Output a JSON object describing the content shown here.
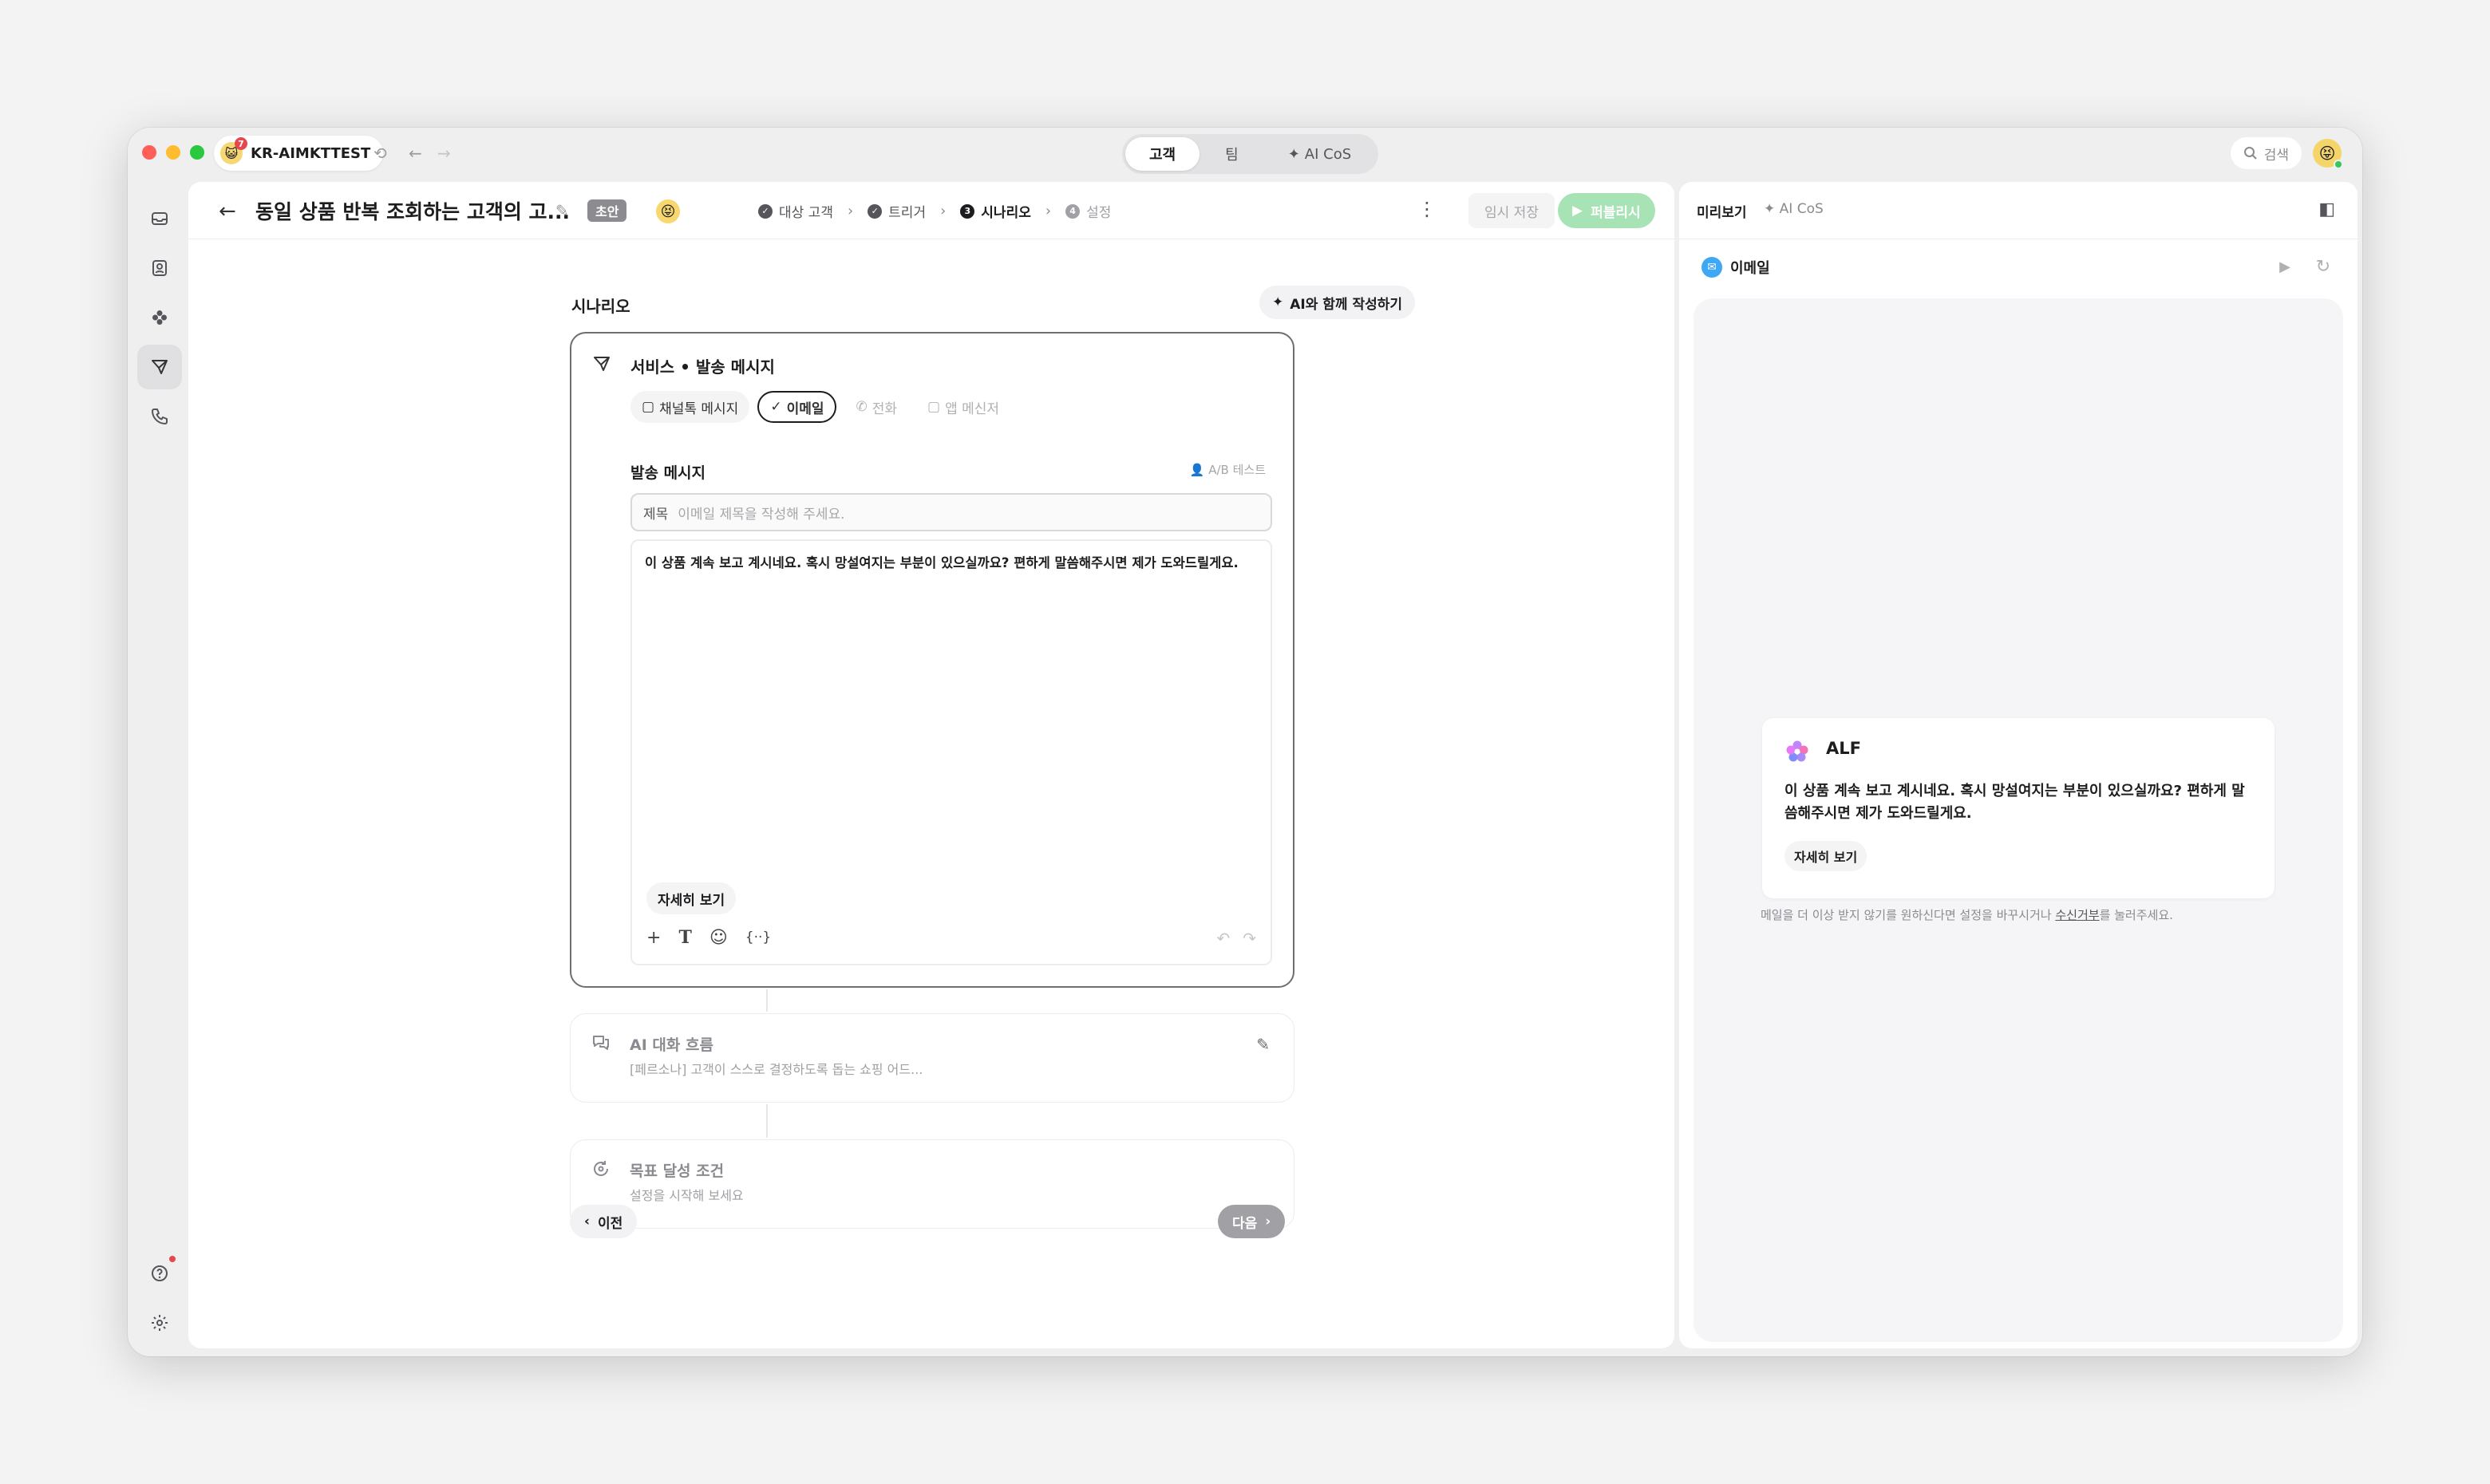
{
  "titlebar": {
    "workspace": "KR-AIMKTTEST",
    "workspace_badge": "7",
    "tabs": [
      "고객",
      "팀",
      "AI CoS"
    ],
    "active_tab": 0,
    "search_label": "검색"
  },
  "header": {
    "title": "동일 상품 반복 조회하는 고객의 고...",
    "status_badge": "초안",
    "steps": [
      {
        "label": "대상 고객",
        "state": "done"
      },
      {
        "label": "트리거",
        "state": "done"
      },
      {
        "label": "시나리오",
        "state": "current",
        "num": "3"
      },
      {
        "label": "설정",
        "state": "future",
        "num": "4"
      }
    ],
    "temp_save": "임시 저장",
    "publish": "퍼블리시"
  },
  "scenario": {
    "section_title": "시나리오",
    "ai_write": "AI와 함께 작성하기",
    "card_title": "서비스  •  발송 메시지",
    "channels": [
      {
        "label": "채널톡 메시지",
        "state": "unselected"
      },
      {
        "label": "이메일",
        "state": "selected"
      },
      {
        "label": "전화",
        "state": "disabled"
      },
      {
        "label": "앱 메신저",
        "state": "disabled"
      }
    ],
    "message_label": "발송 메시지",
    "ab_test": "A/B 테스트",
    "subject_label": "제목",
    "subject_placeholder": "이메일 제목을 작성해 주세요.",
    "body": "이 상품 계속 보고 계시네요. 혹시 망설여지는 부분이 있으실까요? 편하게 말씀해주시면 제가 도와드릴게요.",
    "detail_button": "자세히 보기",
    "ai_flow_title": "AI 대화 흐름",
    "ai_flow_sub": "[페르소나] 고객이 스스로 결정하도록 돕는 쇼핑 어드...",
    "goal_title": "목표 달성 조건",
    "goal_sub": "설정을 시작해 보세요",
    "prev": "이전",
    "next": "다음"
  },
  "preview": {
    "tab_preview": "미리보기",
    "tab_ai": "AI CoS",
    "channel": "이메일",
    "sender": "ALF",
    "message": "이 상품 계속 보고 계시네요. 혹시 망설여지는 부분이 있으실까요? 편하게 말씀해주시면 제가 도와드릴게요.",
    "detail_button": "자세히 보기",
    "unsub_prefix": "메일을 더 이상 받지 않기를 원하신다면 설정을 바꾸시거나 ",
    "unsub_link": "수신거부",
    "unsub_suffix": "를 눌러주세요."
  },
  "colors": {
    "publish_bg": "#a8e3b6",
    "email_icon": "#3ea8f5",
    "notification_dot": "#e5484d"
  }
}
